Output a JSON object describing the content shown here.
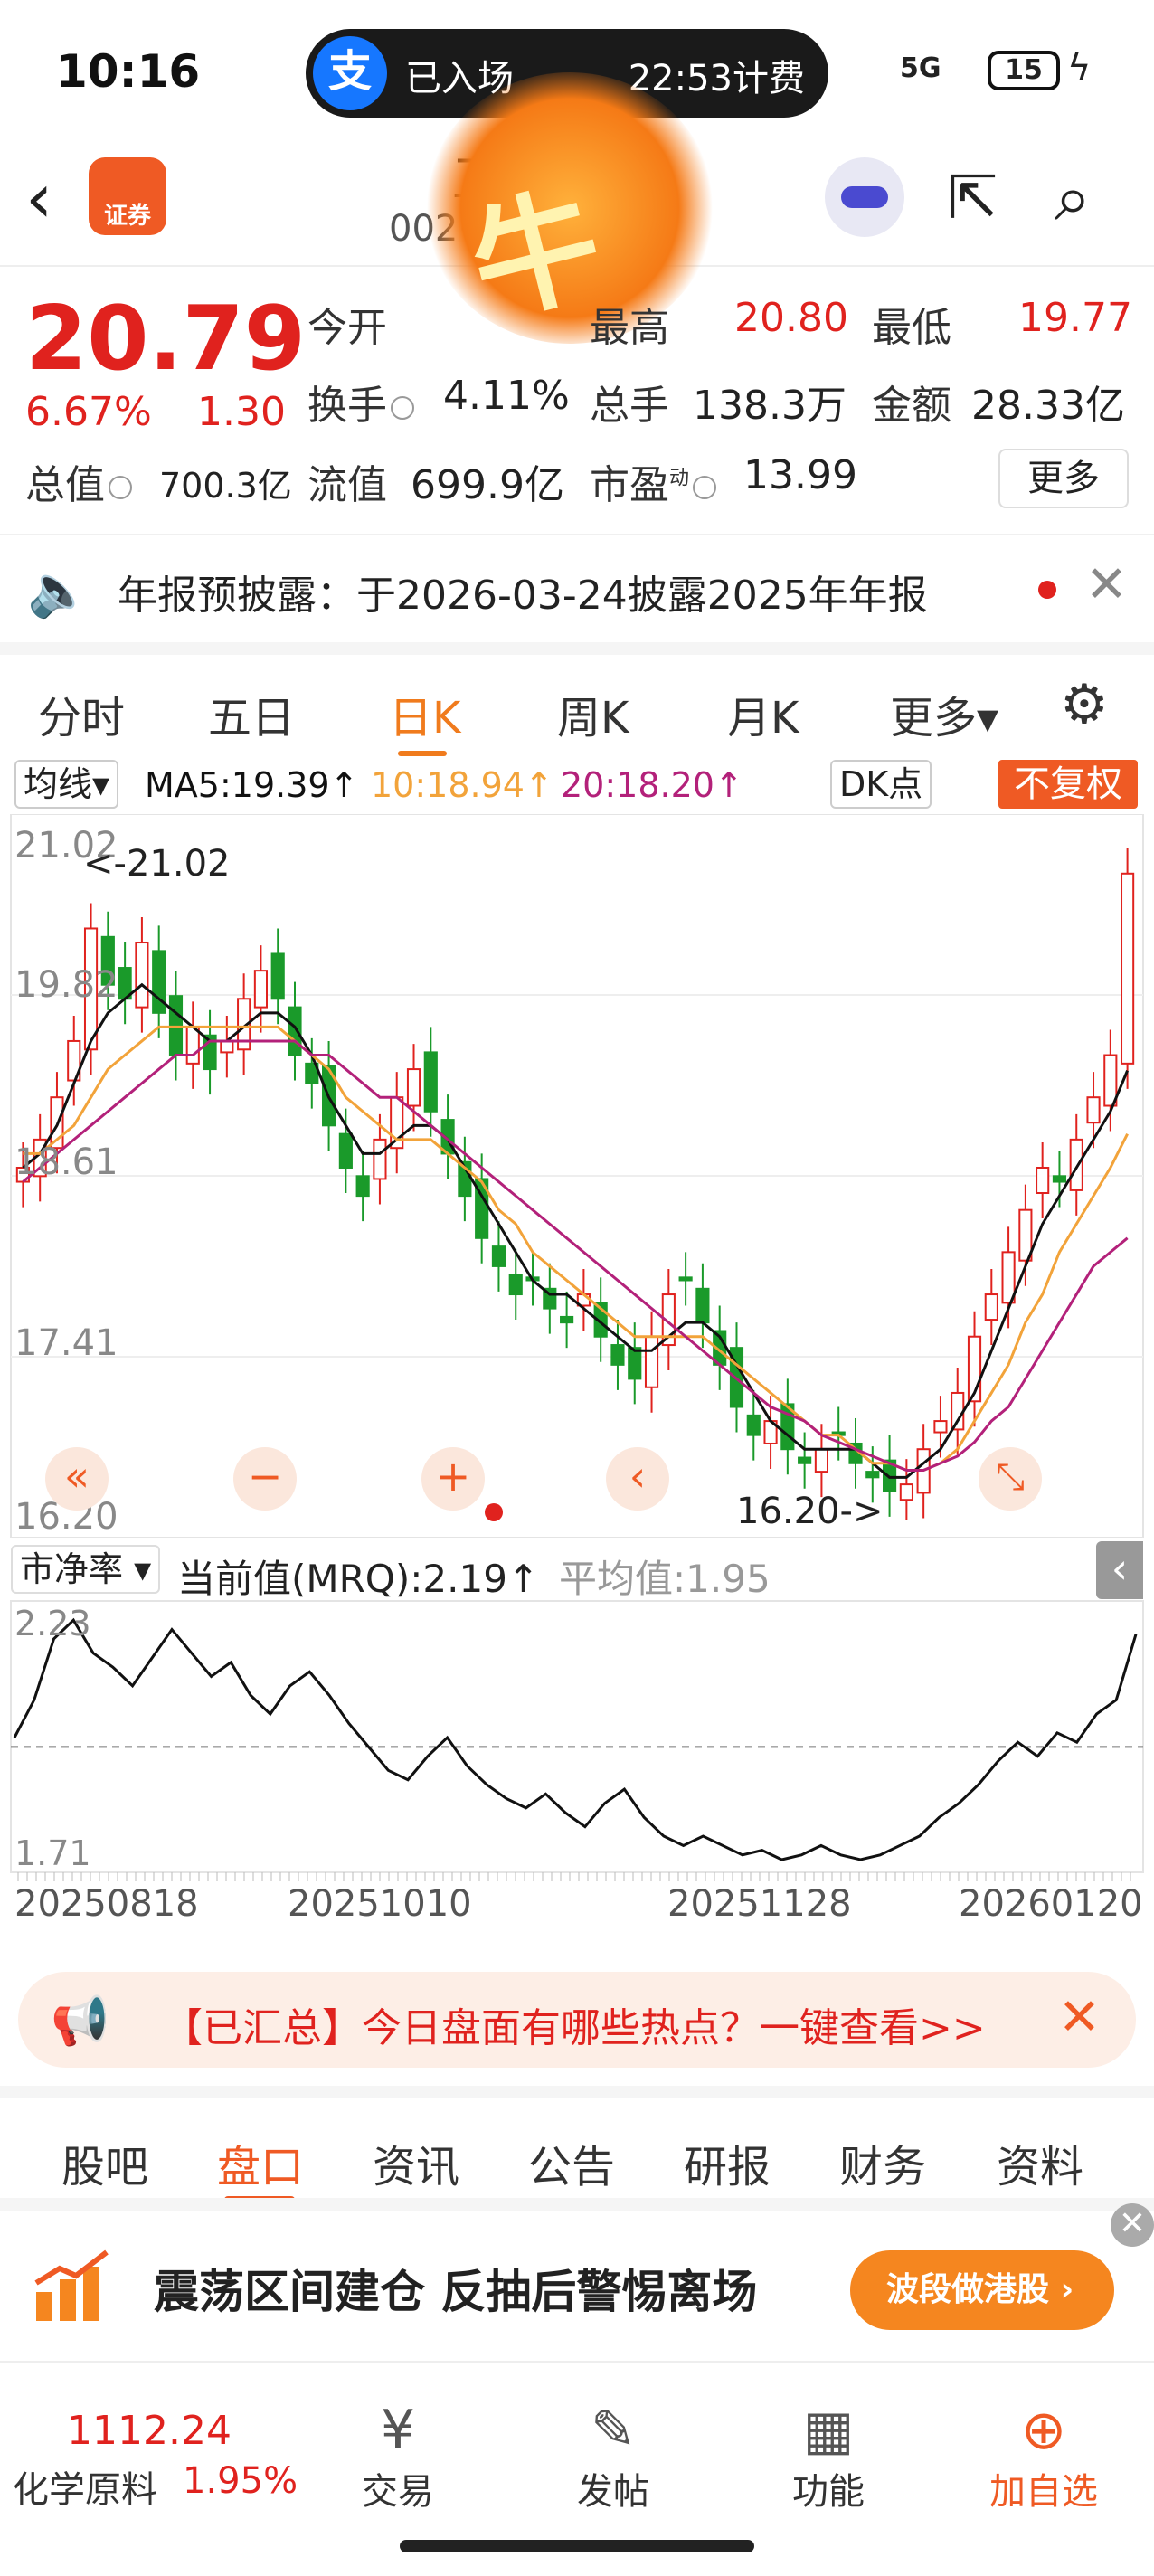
{
  "status": {
    "time": "10:16",
    "alipay_logo": "支",
    "alipay_in": "已入场",
    "alipay_fee": "22:53计费",
    "signal": "5G",
    "battery": "15",
    "bolt": "ϟ"
  },
  "header": {
    "back": "‹",
    "logo_text": "证券",
    "stock_name": "卫星",
    "stock_code": "002·12",
    "sticker": "牛",
    "share_icon": "share-icon",
    "search_icon": "search-icon"
  },
  "quote": {
    "price": "20.79",
    "pct": "6.67%",
    "change": "1.30",
    "open_label": "今开",
    "open": "",
    "high_label": "最高",
    "high": "20.80",
    "low_label": "最低",
    "low": "19.77",
    "turnover_label": "换手",
    "turnover": "4.11%",
    "volume_label": "总手",
    "volume": "138.3万",
    "amount_label": "金额",
    "amount": "28.33亿",
    "mktcap_label": "总值",
    "mktcap": "700.3亿",
    "float_label": "流值",
    "float": "699.9亿",
    "pe_label": "市盈",
    "pe_sup": "动",
    "pe": "13.99",
    "more": "更多"
  },
  "notice": {
    "text": "年报预披露：于2026-03-24披露2025年年报",
    "close": "✕"
  },
  "chart_tabs": [
    "分时",
    "五日",
    "日K",
    "周K",
    "月K",
    "更多▾"
  ],
  "ma": {
    "selector": "均线▾",
    "ma5": "MA5:19.39↑",
    "ma10": "10:18.94↑",
    "ma20": "20:18.20↑",
    "dk": "DK点",
    "fq": "不复权"
  },
  "kchart_labels": {
    "y_labels": [
      "21.02",
      "19.82",
      "18.61",
      "17.41",
      "16.20"
    ],
    "high_note": "<-21.02",
    "low_note": "16.20->"
  },
  "chart_controls": [
    "«",
    "−",
    "+",
    "‹",
    "⤡"
  ],
  "pb": {
    "selector": "市净率 ▾",
    "current": "当前值(MRQ):2.19↑",
    "average": "平均值:1.95",
    "collapse": "‹"
  },
  "pb_axis": {
    "y_top": "2.23",
    "y_bottom": "1.71",
    "dates": [
      "20250818",
      "20251010",
      "20251128",
      "20260120"
    ]
  },
  "hotbar": {
    "text": "【已汇总】今日盘面有哪些热点？一键查看>>",
    "close": "✕"
  },
  "bottom_tabs": [
    "股吧",
    "盘口",
    "资讯",
    "公告",
    "研报",
    "财务",
    "资料"
  ],
  "ad": {
    "text": "震荡区间建仓 反抽后警惕离场",
    "button": "波段做港股 ›",
    "close": "✕"
  },
  "bottom_nav": {
    "index_value": "1112.24",
    "index_name": "化学原料",
    "index_pct": "1.95%",
    "items": [
      {
        "icon": "¥",
        "label": "交易"
      },
      {
        "icon": "✎",
        "label": "发帖"
      },
      {
        "icon": "▦",
        "label": "功能"
      },
      {
        "icon": "⊕",
        "label": "加自选"
      }
    ]
  },
  "colors": {
    "up": "#e0221e",
    "down": "#1a9a2a",
    "accent": "#ef5a24",
    "ma5": "#111111",
    "ma10": "#f2a33a",
    "ma20": "#b3217a"
  },
  "chart_data": [
    {
      "type": "candlestick",
      "y_range": [
        16.2,
        21.02
      ],
      "y_ticks": [
        21.02,
        19.82,
        18.61,
        17.41,
        16.2
      ],
      "high": 21.02,
      "low": 16.2,
      "close_series": [
        18.7,
        18.9,
        19.2,
        19.6,
        20.4,
        20.0,
        19.9,
        20.3,
        19.8,
        19.5,
        19.7,
        19.4,
        19.6,
        19.9,
        20.1,
        19.9,
        19.5,
        19.3,
        19.0,
        18.7,
        18.5,
        18.9,
        19.2,
        19.4,
        19.1,
        18.8,
        18.5,
        18.2,
        18.0,
        17.8,
        17.9,
        17.7,
        17.6,
        17.8,
        17.5,
        17.3,
        17.2,
        17.5,
        17.8,
        17.9,
        17.6,
        17.3,
        17.0,
        16.8,
        16.9,
        16.7,
        16.6,
        16.7,
        16.8,
        16.6,
        16.5,
        16.4,
        16.45,
        16.7,
        16.9,
        17.1,
        17.5,
        17.8,
        18.1,
        18.4,
        18.7,
        18.6,
        18.9,
        19.2,
        19.5,
        20.79
      ],
      "ma_series": [
        {
          "name": "MA5",
          "values": [
            18.7,
            18.8,
            19.0,
            19.3,
            19.6,
            19.8,
            19.9,
            20.0,
            19.9,
            19.8,
            19.7,
            19.6,
            19.6,
            19.7,
            19.8,
            19.8,
            19.7,
            19.5,
            19.2,
            19.0,
            18.8,
            18.8,
            18.9,
            19.0,
            19.0,
            18.9,
            18.7,
            18.5,
            18.3,
            18.1,
            17.9,
            17.8,
            17.8,
            17.7,
            17.6,
            17.5,
            17.4,
            17.4,
            17.5,
            17.6,
            17.6,
            17.5,
            17.3,
            17.1,
            16.9,
            16.8,
            16.7,
            16.7,
            16.7,
            16.7,
            16.6,
            16.5,
            16.5,
            16.6,
            16.7,
            16.9,
            17.1,
            17.4,
            17.7,
            18.0,
            18.3,
            18.5,
            18.7,
            18.9,
            19.1,
            19.39
          ]
        },
        {
          "name": "MA10",
          "values": [
            18.8,
            18.8,
            18.9,
            19.0,
            19.2,
            19.4,
            19.5,
            19.6,
            19.7,
            19.7,
            19.7,
            19.7,
            19.7,
            19.7,
            19.7,
            19.7,
            19.6,
            19.5,
            19.4,
            19.2,
            19.1,
            19.0,
            18.9,
            18.9,
            18.9,
            18.8,
            18.7,
            18.6,
            18.4,
            18.3,
            18.1,
            18.0,
            17.9,
            17.8,
            17.7,
            17.6,
            17.5,
            17.5,
            17.5,
            17.5,
            17.5,
            17.4,
            17.3,
            17.2,
            17.1,
            17.0,
            16.9,
            16.8,
            16.8,
            16.7,
            16.6,
            16.6,
            16.55,
            16.55,
            16.6,
            16.7,
            16.9,
            17.1,
            17.3,
            17.6,
            17.8,
            18.1,
            18.3,
            18.5,
            18.7,
            18.94
          ]
        },
        {
          "name": "MA20",
          "values": [
            18.6,
            18.7,
            18.8,
            18.9,
            19.0,
            19.1,
            19.2,
            19.3,
            19.4,
            19.5,
            19.5,
            19.6,
            19.6,
            19.6,
            19.6,
            19.6,
            19.6,
            19.5,
            19.5,
            19.4,
            19.3,
            19.2,
            19.2,
            19.1,
            19.0,
            18.9,
            18.8,
            18.7,
            18.6,
            18.5,
            18.4,
            18.3,
            18.2,
            18.1,
            18.0,
            17.9,
            17.8,
            17.7,
            17.6,
            17.5,
            17.4,
            17.3,
            17.2,
            17.1,
            17.0,
            16.95,
            16.9,
            16.8,
            16.75,
            16.7,
            16.65,
            16.6,
            16.55,
            16.55,
            16.6,
            16.65,
            16.75,
            16.9,
            17.0,
            17.2,
            17.4,
            17.6,
            17.8,
            18.0,
            18.1,
            18.2
          ]
        }
      ]
    },
    {
      "type": "line",
      "name": "市净率",
      "y_range": [
        1.71,
        2.23
      ],
      "average": 1.95,
      "x_ticks": [
        "20250818",
        "20251010",
        "20251128",
        "20260120"
      ],
      "values": [
        1.97,
        2.05,
        2.18,
        2.22,
        2.15,
        2.12,
        2.08,
        2.14,
        2.2,
        2.15,
        2.1,
        2.13,
        2.06,
        2.02,
        2.08,
        2.11,
        2.06,
        2.0,
        1.95,
        1.9,
        1.88,
        1.93,
        1.97,
        1.91,
        1.87,
        1.84,
        1.82,
        1.85,
        1.81,
        1.78,
        1.83,
        1.86,
        1.8,
        1.76,
        1.74,
        1.76,
        1.74,
        1.72,
        1.73,
        1.71,
        1.72,
        1.74,
        1.72,
        1.71,
        1.72,
        1.74,
        1.76,
        1.8,
        1.83,
        1.87,
        1.92,
        1.96,
        1.93,
        1.98,
        1.96,
        2.02,
        2.05,
        2.19
      ]
    }
  ]
}
